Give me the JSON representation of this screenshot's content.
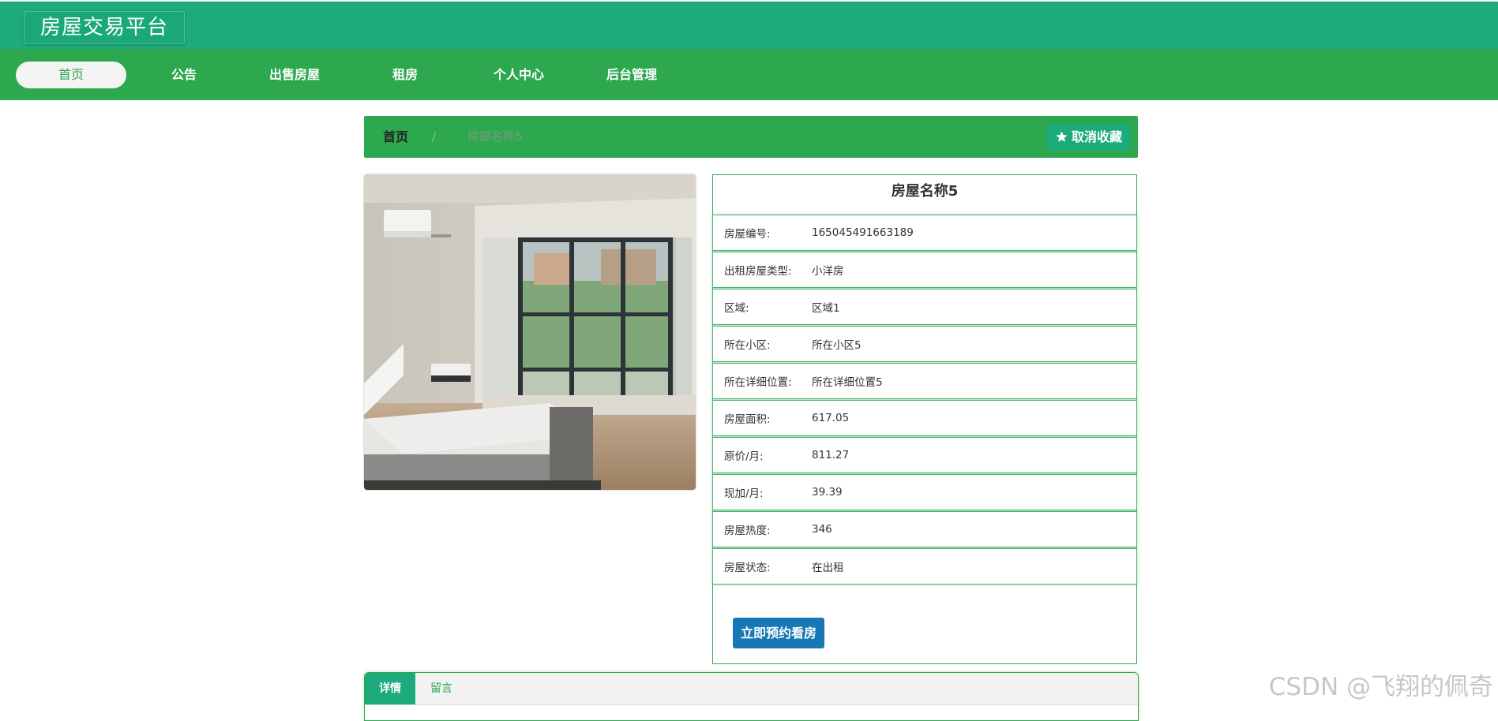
{
  "app": {
    "title": "房屋交易平台"
  },
  "nav": {
    "items": [
      {
        "label": "首页",
        "active": true
      },
      {
        "label": "公告"
      },
      {
        "label": "出售房屋"
      },
      {
        "label": "租房"
      },
      {
        "label": "个人中心"
      },
      {
        "label": "后台管理"
      }
    ]
  },
  "breadcrumb": {
    "home": "首页",
    "separator": "/",
    "current": "房屋名称5"
  },
  "actions": {
    "unfavorite_label": "取消收藏",
    "book_label": "立即预约看房"
  },
  "house": {
    "title": "房屋名称5",
    "rows": [
      {
        "label": "房屋编号:",
        "value": "165045491663189"
      },
      {
        "label": "出租房屋类型:",
        "value": "小洋房"
      },
      {
        "label": "区域:",
        "value": "区域1"
      },
      {
        "label": "所在小区:",
        "value": "所在小区5"
      },
      {
        "label": "所在详细位置:",
        "value": "所在详细位置5"
      },
      {
        "label": "房屋面积:",
        "value": "617.05"
      },
      {
        "label": "原价/月:",
        "value": "811.27"
      },
      {
        "label": "现加/月:",
        "value": "39.39"
      },
      {
        "label": "房屋热度:",
        "value": "346"
      },
      {
        "label": "房屋状态:",
        "value": "在出租"
      }
    ]
  },
  "tabs": [
    {
      "label": "详情",
      "active": true
    },
    {
      "label": "留言"
    }
  ],
  "watermark": "CSDN @飞翔的佩奇",
  "colors": {
    "topbar": "#1dab7e",
    "navbar": "#2ea84f",
    "primary_button": "#1877b5"
  }
}
